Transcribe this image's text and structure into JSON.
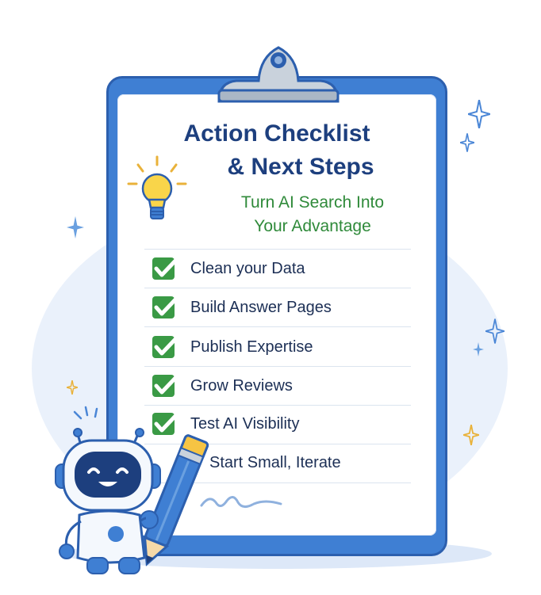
{
  "header": {
    "title_line1": "Action Checklist",
    "title_line2": "& Next Steps",
    "subtitle_line1": "Turn AI Search Into",
    "subtitle_line2": "Your Advantage"
  },
  "checklist": [
    {
      "label": "Clean your Data",
      "checked": true
    },
    {
      "label": "Build Answer Pages",
      "checked": true
    },
    {
      "label": "Publish Expertise",
      "checked": true
    },
    {
      "label": "Grow Reviews",
      "checked": true
    },
    {
      "label": "Test AI Visibility",
      "checked": true
    },
    {
      "label": "Start Small, Iterate",
      "checked": false
    }
  ],
  "colors": {
    "board": "#3f7fd3",
    "title": "#1d3f7e",
    "subtitle": "#2f8a3a",
    "check": "#3a9a45"
  },
  "icons": [
    "clipboard-clip-icon",
    "lightbulb-icon",
    "check-icon",
    "sparkle-icon",
    "robot-mascot",
    "pencil-icon"
  ]
}
